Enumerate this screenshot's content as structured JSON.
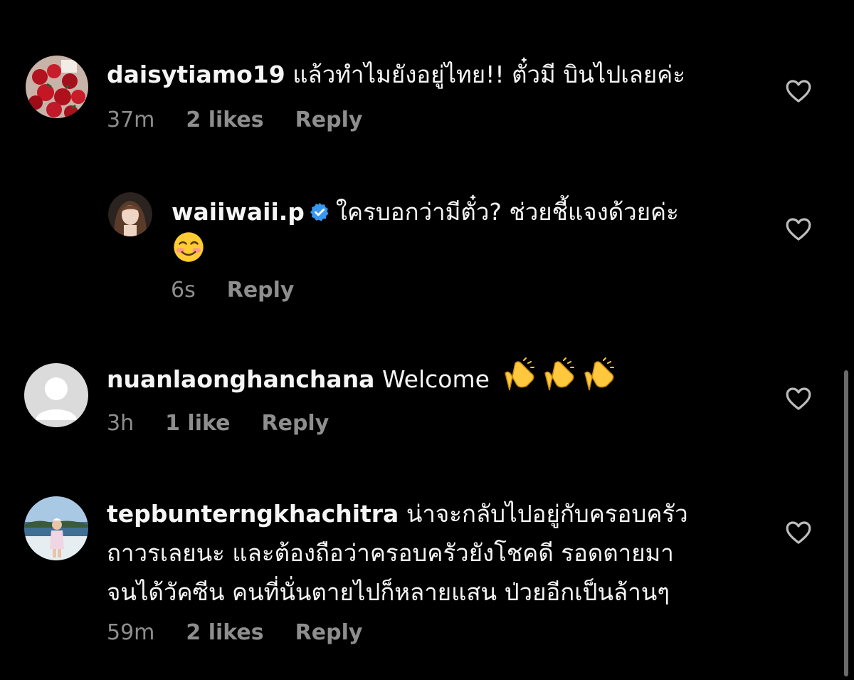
{
  "comments": [
    {
      "username": "daisytiamo19",
      "text": "แล้วทำไมยังอยู่ไทย!! ตั๋วมี บินไปเลยค่ะ",
      "time": "37m",
      "likes": "2 likes",
      "reply": "Reply",
      "avatar_icon": "roses-avatar"
    },
    {
      "username": "waiiwaii.p",
      "verified": true,
      "text": "ใครบอกว่ามีตั๋ว? ช่วยชี้แจงด้วยค่ะ",
      "emoji": "smiling-face-emoji",
      "time": "6s",
      "reply": "Reply",
      "avatar_icon": "woman-portrait-avatar"
    },
    {
      "username": "nuanlaonghanchana",
      "text": "Welcome",
      "emoji": "clapping-hands-emoji x3",
      "time": "3h",
      "likes": "1 like",
      "reply": "Reply",
      "avatar_icon": "default-user-avatar"
    },
    {
      "username": "tepbunterngkhachitra",
      "text_lines": [
        "น่าจะกลับไปอยู่กับครอบครัว",
        "ถาวรเลยนะ และต้องถือว่าครอบครัวยังโชคดี รอดตายมา",
        "จนได้วัคซีน คนที่นั่นตายไปก็หลายแสน ป่วยอีกเป็นล้านๆ"
      ],
      "time": "59m",
      "likes": "2 likes",
      "reply": "Reply",
      "avatar_icon": "beach-photo-avatar"
    }
  ],
  "colors": {
    "background": "#000000",
    "text": "#f5f5f5",
    "meta": "#8e8e8e",
    "verified": "#3897f0"
  },
  "icons": {
    "like": "heart-outline-icon",
    "verified": "verified-badge-icon"
  }
}
